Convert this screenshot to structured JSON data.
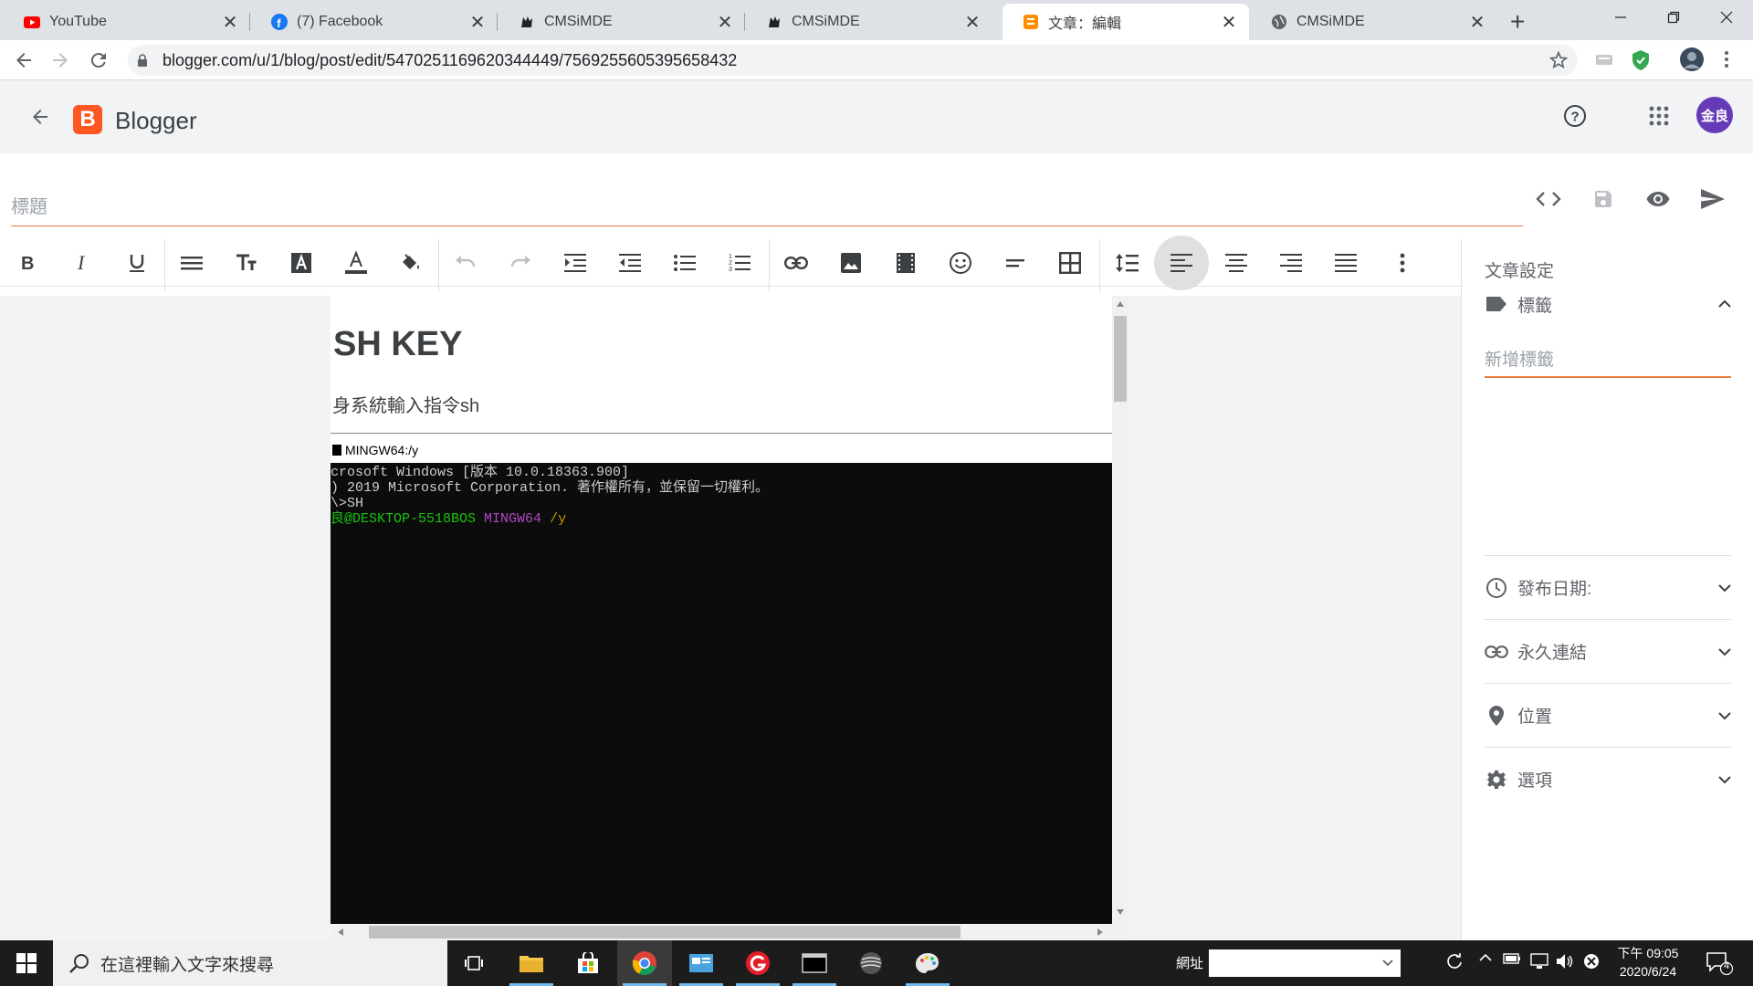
{
  "browser": {
    "tabs": [
      {
        "title": "YouTube",
        "icon": "youtube-icon",
        "active": false
      },
      {
        "title": "(7) Facebook",
        "icon": "facebook-icon",
        "active": false
      },
      {
        "title": "CMSiMDE",
        "icon": "cmsimde-icon",
        "active": false
      },
      {
        "title": "CMSiMDE",
        "icon": "cmsimde-icon",
        "active": false
      },
      {
        "title": "文章：編輯",
        "icon": "blogger-icon",
        "active": true
      },
      {
        "title": "CMSiMDE",
        "icon": "globe-icon",
        "active": false
      }
    ],
    "url": "blogger.com/u/1/blog/post/edit/5470251169620344449/7569255605395658432"
  },
  "app": {
    "name": "Blogger",
    "logo_letter": "B",
    "avatar": "金良",
    "accent": "#ff5722"
  },
  "editor": {
    "title_placeholder": "標題",
    "heading": "SH KEY",
    "paragraph": "身系統輸入指令sh",
    "terminal_window_title": "MINGW64:/y",
    "terminal_lines": [
      "crosoft Windows [版本 10.0.18363.900]",
      ") 2019 Microsoft Corporation. 著作權所有，並保留一切權利。",
      "",
      "\\>SH",
      ""
    ],
    "terminal_prompt": {
      "user_host": "良@DESKTOP-5518BOS",
      "shell": "MINGW64",
      "path": "/y"
    }
  },
  "side_panel": {
    "title": "文章設定",
    "labels_section": "標籤",
    "labels_placeholder": "新增標籤",
    "publish_date": "發布日期:",
    "permalink": "永久連結",
    "location": "位置",
    "options": "選項"
  },
  "taskbar": {
    "search_placeholder": "在這裡輸入文字來搜尋",
    "address_label": "網址",
    "time": "下午 09:05",
    "date": "2020/6/24",
    "notification_count": "4"
  }
}
